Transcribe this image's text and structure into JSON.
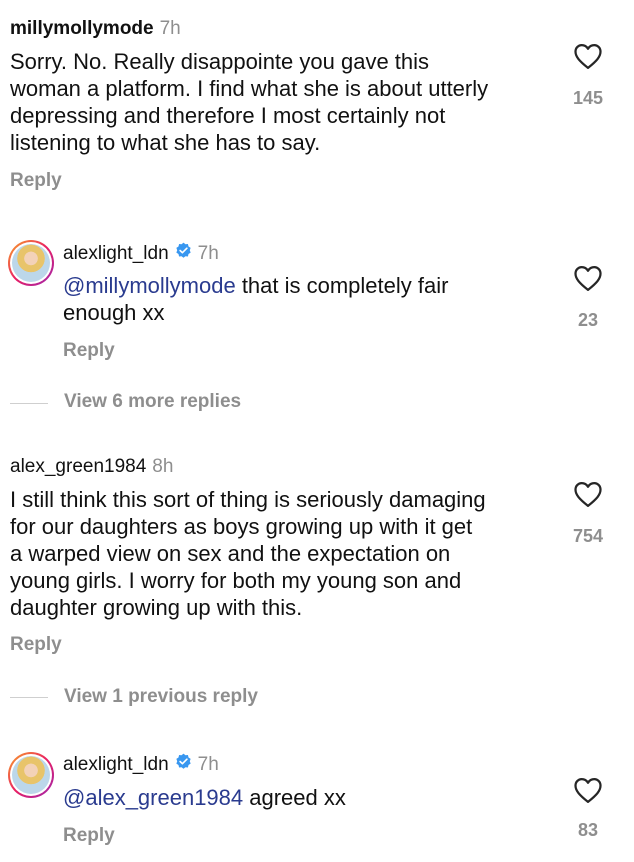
{
  "comments": [
    {
      "username": "millymollymode",
      "time": "7h",
      "text": "Sorry. No. Really disappointe you gave this\nwoman a platform. I find what she is about utterly\ndepressing and therefore I most certainly not\nlistening to what she has to say.",
      "reply_label": "Reply",
      "likes": "145"
    },
    {
      "username": "alexlight_ldn",
      "time": "7h",
      "mention": "@millymollymode",
      "text": " that is completely fair\nenough xx",
      "reply_label": "Reply",
      "likes": "23",
      "view_replies": "View 6 more replies"
    },
    {
      "username": "alex_green1984",
      "time": "8h",
      "text": "I still think this sort of thing is seriously damaging\nfor our daughters as boys growing up with it get\na warped view on sex and the expectation on\nyoung girls. I worry for both my young son and\ndaughter growing up with this.",
      "reply_label": "Reply",
      "likes": "754",
      "view_replies": "View 1 previous reply"
    },
    {
      "username": "alexlight_ldn",
      "time": "7h",
      "mention": "@alex_green1984",
      "text": " agreed xx",
      "reply_label": "Reply",
      "likes": "83"
    }
  ],
  "colors": {
    "mention": "#2a3b8f",
    "muted": "#8e8e8e",
    "verified": "#3897f0"
  },
  "icons": {
    "like": "heart-outline-icon",
    "verified": "verified-badge-icon"
  }
}
